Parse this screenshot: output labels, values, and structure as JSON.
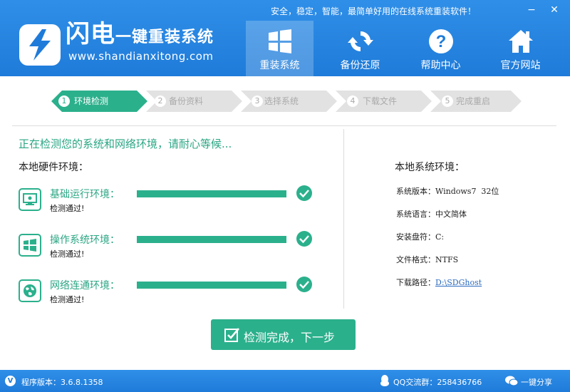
{
  "header": {
    "tagline": "安全，稳定，智能，最简单好用的在线系统重装软件！",
    "brand_main": "闪电",
    "brand_sub": "一键重装系统",
    "brand_url": "www.shandianxitong.com",
    "nav": [
      {
        "label": "重装系统",
        "icon": "windows-icon",
        "active": true
      },
      {
        "label": "备份还原",
        "icon": "sync-icon",
        "active": false
      },
      {
        "label": "帮助中心",
        "icon": "question-icon",
        "active": false
      },
      {
        "label": "官方网站",
        "icon": "home-icon",
        "active": false
      }
    ],
    "minimize": "−",
    "close": "✕"
  },
  "steps": [
    {
      "num": "1",
      "label": "环境检测",
      "active": true
    },
    {
      "num": "2",
      "label": "备份资料",
      "active": false
    },
    {
      "num": "3",
      "label": "选择系统",
      "active": false
    },
    {
      "num": "4",
      "label": "下载文件",
      "active": false
    },
    {
      "num": "5",
      "label": "完成重启",
      "active": false
    }
  ],
  "checking": {
    "title": "正在检测您的系统和网络环境，请耐心等候...",
    "hw_title": "本地硬件环境：",
    "rows": [
      {
        "label": "基础运行环境：",
        "status": "检测通过!",
        "progress": 1.0,
        "icon": "monitor-icon"
      },
      {
        "label": "操作系统环境：",
        "status": "检测通过!",
        "progress": 1.0,
        "icon": "windows-icon"
      },
      {
        "label": "网络连通环境：",
        "status": "检测通过!",
        "progress": 1.0,
        "icon": "globe-icon"
      }
    ]
  },
  "system": {
    "title": "本地系统环境：",
    "rows": [
      {
        "key": "系统版本：",
        "value": "Windows7  32位"
      },
      {
        "key": "系统语言：",
        "value": "中文简体"
      },
      {
        "key": "安装盘符：",
        "value": "C:"
      },
      {
        "key": "文件格式：",
        "value": "NTFS"
      },
      {
        "key": "下载路径：",
        "value": "D:\\SDGhost"
      }
    ]
  },
  "next_button": "检测完成，下一步",
  "footer": {
    "version": "程序版本：3.6.8.1358",
    "qq": "QQ交流群：258436766",
    "share": "一键分享",
    "v_badge": "V"
  },
  "colors": {
    "header_blue": "#1f7bd9",
    "accent_green": "#2bb08c",
    "step_inactive": "#e2e2e2"
  }
}
